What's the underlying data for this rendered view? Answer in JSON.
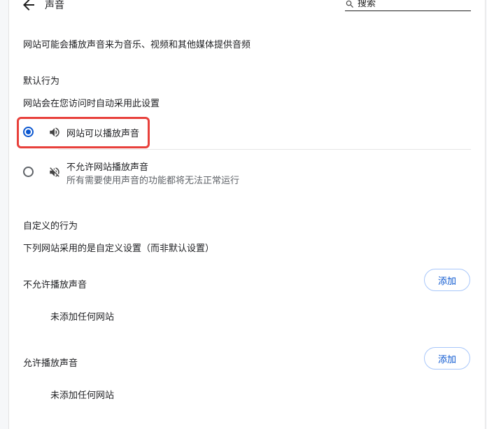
{
  "header": {
    "back_icon": "arrow-left-icon",
    "title": "声音",
    "search_icon": "search-icon",
    "search_placeholder": "搜索"
  },
  "intro": "网站可能会播放声音来为音乐、视频和其他媒体提供音频",
  "default_behavior": {
    "heading": "默认行为",
    "description": "网站会在您访问时自动采用此设置",
    "options": [
      {
        "label": "网站可以播放声音",
        "sub": "",
        "selected": true,
        "icon": "speaker-icon"
      },
      {
        "label": "不允许网站播放声音",
        "sub": "所有需要使用声音的功能都将无法正常运行",
        "selected": false,
        "icon": "speaker-muted-icon"
      }
    ]
  },
  "custom_behavior": {
    "heading": "自定义的行为",
    "description": "下列网站采用的是自定义设置（而非默认设置）",
    "sections": [
      {
        "title": "不允许播放声音",
        "add_label": "添加",
        "empty_text": "未添加任何网站"
      },
      {
        "title": "允许播放声音",
        "add_label": "添加",
        "empty_text": "未添加任何网站"
      }
    ]
  },
  "colors": {
    "accent": "#0b57d0",
    "highlight": "#e8403b"
  }
}
